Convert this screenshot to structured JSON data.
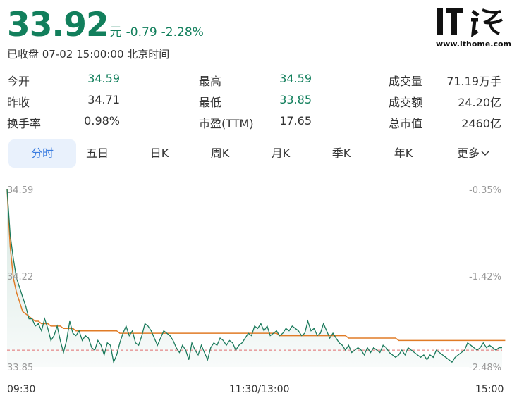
{
  "quote": {
    "price": "33.92",
    "unit": "元",
    "change": "-0.79",
    "change_pct": "-2.28%",
    "status": "已收盘 07-02 15:00:00 北京时间"
  },
  "logo": {
    "text": "IT之家",
    "url": "www.ithome.com"
  },
  "stats": [
    {
      "label": "今开",
      "value": "34.59"
    },
    {
      "label": "最高",
      "value": "34.59"
    },
    {
      "label": "成交量",
      "value": "71.19万手"
    },
    {
      "label": "昨收",
      "value": "34.71"
    },
    {
      "label": "最低",
      "value": "33.85"
    },
    {
      "label": "成交额",
      "value": "24.20亿"
    },
    {
      "label": "换手率",
      "value": "0.98%"
    },
    {
      "label": "市盈(TTM)",
      "value": "17.65"
    },
    {
      "label": "总市值",
      "value": "2460亿"
    }
  ],
  "tabs": [
    "分时",
    "五日",
    "日K",
    "周K",
    "月K",
    "季K",
    "年K",
    "更多"
  ],
  "colors": {
    "price": "#127f5c",
    "accent_tab": "#3b7de0",
    "price_line": "#1b7a5c",
    "avg_line": "#e07b26",
    "prev_close": "#e06e6e"
  },
  "chart_data": {
    "type": "line",
    "y_left_ticks": [
      "34.59",
      "34.22",
      "33.85"
    ],
    "y_right_ticks": [
      "-0.35%",
      "-1.42%",
      "-2.48%"
    ],
    "x_ticks": [
      "09:30",
      "11:30/13:00",
      "15:00"
    ],
    "ylim": [
      33.85,
      34.59
    ],
    "prev_close": 33.92,
    "series": [
      {
        "values": [
          34.59,
          34.4,
          34.3,
          34.22,
          34.18,
          34.14,
          34.1,
          34.05,
          34.05,
          34.02,
          34.03,
          34.0,
          34.05,
          34.01,
          33.96,
          33.98,
          34.02,
          33.96,
          33.91,
          33.96,
          34.04,
          33.99,
          33.98,
          34.0,
          33.96,
          33.98,
          33.97,
          33.93,
          33.92,
          33.96,
          33.94,
          33.9,
          33.95,
          33.94,
          33.87,
          33.9,
          33.95,
          33.99,
          34.02,
          33.98,
          34.0,
          33.95,
          33.94,
          33.98,
          34.03,
          34.02,
          34.0,
          33.97,
          33.94,
          33.97,
          34.0,
          33.99,
          33.98,
          33.96,
          33.93,
          33.91,
          33.94,
          33.92,
          33.88,
          33.95,
          33.92,
          33.9,
          33.94,
          33.91,
          33.88,
          33.93,
          33.95,
          33.94,
          33.97,
          33.96,
          33.94,
          33.96,
          33.95,
          33.92,
          33.94,
          33.95,
          33.97,
          33.99,
          33.98,
          34.02,
          34.01,
          34.03,
          34.0,
          34.02,
          33.98,
          33.99,
          34.0,
          33.98,
          33.99,
          34.01,
          34.0,
          34.02,
          34.01,
          34.0,
          33.98,
          33.99,
          34.04,
          34.0,
          34.01,
          33.98,
          33.99,
          34.03,
          34.0,
          33.97,
          33.99,
          33.97,
          33.95,
          33.94,
          33.92,
          33.94,
          33.91,
          33.92,
          33.93,
          33.92,
          33.9,
          33.93,
          33.91,
          33.93,
          33.92,
          33.91,
          33.94,
          33.93,
          33.91,
          33.9,
          33.89,
          33.9,
          33.92,
          33.9,
          33.93,
          33.92,
          33.91,
          33.9,
          33.89,
          33.9,
          33.88,
          33.9,
          33.89,
          33.92,
          33.91,
          33.9,
          33.89,
          33.88,
          33.87,
          33.89,
          33.9,
          33.91,
          33.92,
          33.95,
          33.94,
          33.93,
          33.92,
          33.93,
          33.95,
          33.93,
          33.94,
          33.93,
          33.92,
          33.93,
          33.93
        ]
      },
      {
        "values": [
          34.59,
          34.35,
          34.22,
          34.16,
          34.12,
          34.08,
          34.07,
          34.06,
          34.05,
          34.04,
          34.04,
          34.03,
          34.03,
          34.03,
          34.02,
          34.02,
          34.02,
          34.02,
          34.01,
          34.01,
          34.01,
          34.01,
          34.0,
          34.0,
          34.0,
          34.0,
          34.0,
          34.0,
          34.0,
          34.0,
          34.0,
          34.0,
          34.0,
          34.0,
          34.0,
          34.0,
          33.99,
          33.99,
          33.99,
          33.99,
          33.99,
          33.99,
          33.99,
          33.99,
          33.99,
          33.99,
          33.99,
          33.99,
          33.99,
          33.99,
          33.99,
          33.99,
          33.99,
          33.99,
          33.99,
          33.99,
          33.99,
          33.99,
          33.99,
          33.99,
          33.99,
          33.99,
          33.99,
          33.99,
          33.99,
          33.99,
          33.99,
          33.99,
          33.99,
          33.99,
          33.99,
          33.99,
          33.99,
          33.99,
          33.99,
          33.99,
          33.99,
          33.99,
          33.99,
          33.99,
          33.99,
          33.99,
          33.99,
          33.99,
          33.99,
          33.99,
          33.99,
          33.98,
          33.98,
          33.98,
          33.98,
          33.98,
          33.98,
          33.98,
          33.98,
          33.98,
          33.98,
          33.98,
          33.98,
          33.98,
          33.98,
          33.98,
          33.98,
          33.98,
          33.98,
          33.98,
          33.98,
          33.98,
          33.98,
          33.97,
          33.97,
          33.97,
          33.97,
          33.97,
          33.97,
          33.97,
          33.97,
          33.97,
          33.97,
          33.97,
          33.97,
          33.97,
          33.97,
          33.97,
          33.97,
          33.96,
          33.96,
          33.96,
          33.96,
          33.96,
          33.96,
          33.96,
          33.96,
          33.96,
          33.96,
          33.96,
          33.96,
          33.96,
          33.96,
          33.96,
          33.96,
          33.96,
          33.96,
          33.96,
          33.96,
          33.96,
          33.96,
          33.96,
          33.96,
          33.96,
          33.96,
          33.96,
          33.96,
          33.96,
          33.96,
          33.96,
          33.96,
          33.96,
          33.96,
          33.96
        ]
      }
    ],
    "grid": false,
    "legend": "none"
  }
}
